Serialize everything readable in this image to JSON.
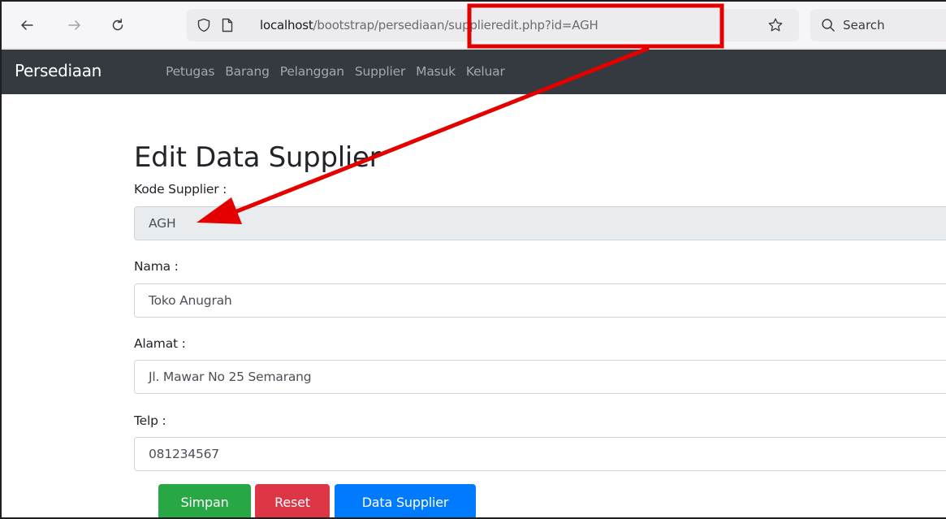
{
  "browser": {
    "url_host": "localhost",
    "url_path": "/bootstrap/persediaan/supplieredit.php?id=AGH",
    "search_placeholder": "Search"
  },
  "navbar": {
    "brand": "Persediaan",
    "links": [
      "Petugas",
      "Barang",
      "Pelanggan",
      "Supplier",
      "Masuk",
      "Keluar"
    ]
  },
  "form": {
    "title": "Edit Data Supplier",
    "kode_label": "Kode Supplier :",
    "kode_value": "AGH",
    "nama_label": "Nama :",
    "nama_value": "Toko Anugrah",
    "alamat_label": "Alamat :",
    "alamat_value": "Jl. Mawar No 25 Semarang",
    "telp_label": "Telp :",
    "telp_value": "081234567"
  },
  "buttons": {
    "simpan": "Simpan",
    "reset": "Reset",
    "data_supplier": "Data Supplier"
  },
  "colors": {
    "navbar_bg": "#343a40",
    "success": "#28a745",
    "danger": "#dc3545",
    "primary": "#007bff",
    "annotation": "#e50000"
  }
}
